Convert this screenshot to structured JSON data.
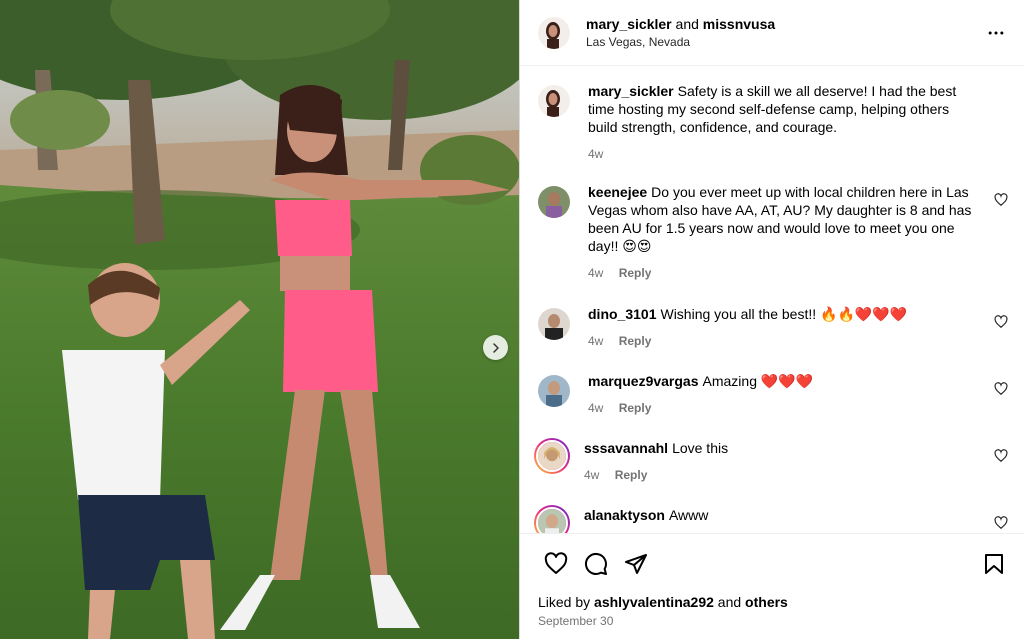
{
  "post": {
    "author": "mary_sickler",
    "joiner": "and",
    "collaborator": "missnvusa",
    "location": "Las Vegas, Nevada"
  },
  "caption": {
    "user": "mary_sickler",
    "text": "Safety is a skill we all deserve! I had the best time hosting my second self-defense camp, helping others build strength, confidence, and courage.",
    "time": "4w"
  },
  "comments": [
    {
      "user": "keenejee",
      "text": "Do you ever meet up with local children here in Las Vegas whom also have AA, AT, AU? My daughter is 8 and has been AU for 1.5 years now and would love to meet you one day!! 😍😍",
      "time": "4w",
      "reply": "Reply"
    },
    {
      "user": "dino_3101",
      "text": "Wishing you all the best!! 🔥🔥❤️❤️❤️",
      "time": "4w",
      "reply": "Reply"
    },
    {
      "user": "marquez9vargas",
      "text": "Amazing ❤️❤️❤️",
      "time": "4w",
      "reply": "Reply"
    },
    {
      "user": "sssavannahl",
      "text": "Love this",
      "time": "4w",
      "reply": "Reply"
    },
    {
      "user": "alanaktyson",
      "text": "Awww",
      "time": "",
      "reply": ""
    }
  ],
  "footer": {
    "liked_prefix": "Liked by",
    "liked_user": "ashlyvalentina292",
    "liked_and": "and",
    "liked_others": "others",
    "date": "September 30"
  },
  "icons": {
    "more": "more-horizontal-icon",
    "next": "chevron-right-icon",
    "like": "heart-icon",
    "comment": "comment-icon",
    "share": "send-icon",
    "save": "bookmark-icon"
  }
}
